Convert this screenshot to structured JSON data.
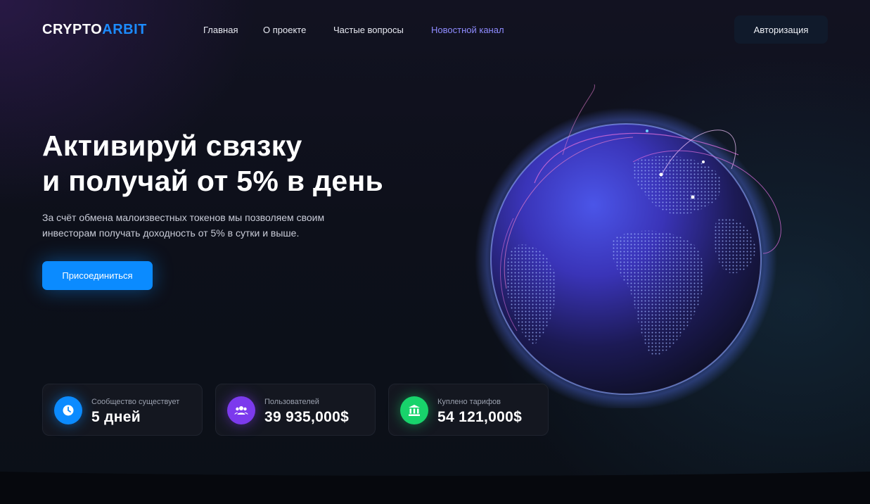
{
  "header": {
    "logo_part1": "CRYPTO",
    "logo_part2": "ARBIT",
    "nav": [
      "Главная",
      "О проекте",
      "Частые вопросы",
      "Новостной канал"
    ],
    "auth_label": "Авторизация"
  },
  "hero": {
    "title_line1": "Активируй связку",
    "title_line2": "и получай от 5% в день",
    "subtitle_line1": "За счёт обмена малоизвестных токенов мы позволяем своим",
    "subtitle_line2": "инвесторам получать доходность от 5% в сутки и выше.",
    "join_label": "Присоединиться"
  },
  "stats": [
    {
      "label": "Сообщество существует",
      "value": "5 дней",
      "icon": "clock-icon"
    },
    {
      "label": "Пользователей",
      "value": "39 935,000$",
      "icon": "users-icon"
    },
    {
      "label": "Куплено тарифов",
      "value": "54 121,000$",
      "icon": "bank-icon"
    }
  ],
  "colors": {
    "accent": "#0b8bff",
    "logo_accent": "#1c8cff",
    "nav_active": "#8f8cff",
    "purple": "#7c3aed",
    "green": "#18d36b"
  }
}
